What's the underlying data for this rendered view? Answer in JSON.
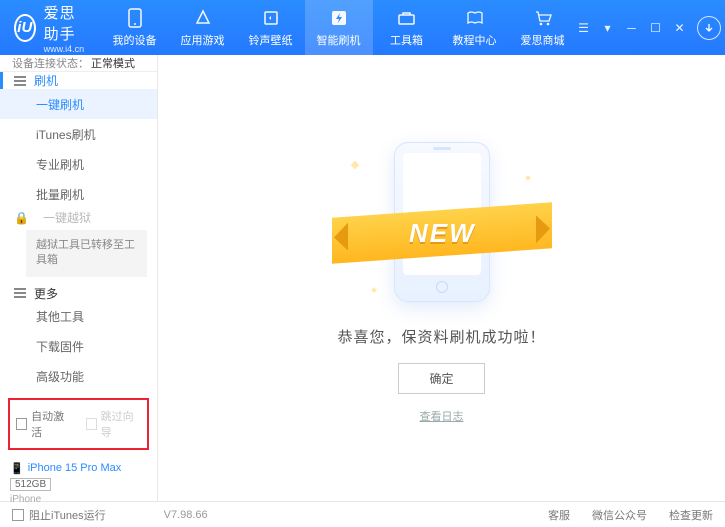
{
  "brand": {
    "logo": "iU",
    "title": "爱思助手",
    "sub": "www.i4.cn"
  },
  "nav": {
    "items": [
      {
        "label": "我的设备"
      },
      {
        "label": "应用游戏"
      },
      {
        "label": "铃声壁纸"
      },
      {
        "label": "智能刷机"
      },
      {
        "label": "工具箱"
      },
      {
        "label": "教程中心"
      },
      {
        "label": "爱思商城"
      }
    ],
    "active_index": 3
  },
  "sidebar": {
    "status_label": "设备连接状态：",
    "status_value": "正常模式",
    "sec1": {
      "title": "刷机",
      "items": [
        {
          "label": "一键刷机",
          "active": true
        },
        {
          "label": "iTunes刷机"
        },
        {
          "label": "专业刷机"
        },
        {
          "label": "批量刷机"
        }
      ]
    },
    "sec2": {
      "title": "一键越狱",
      "note": "越狱工具已转移至工具箱"
    },
    "sec3": {
      "title": "更多",
      "items": [
        {
          "label": "其他工具"
        },
        {
          "label": "下载固件"
        },
        {
          "label": "高级功能"
        }
      ]
    },
    "checks": {
      "auto": "自动激活",
      "skip": "跳过向导"
    },
    "device": {
      "name": "iPhone 15 Pro Max",
      "cap": "512GB",
      "type": "iPhone"
    }
  },
  "main": {
    "ribbon": "NEW",
    "message": "恭喜您，保资料刷机成功啦！",
    "ok": "确定",
    "log": "查看日志"
  },
  "footer": {
    "block_itunes": "阻止iTunes运行",
    "version": "V7.98.66",
    "links": [
      "客服",
      "微信公众号",
      "检查更新"
    ]
  }
}
